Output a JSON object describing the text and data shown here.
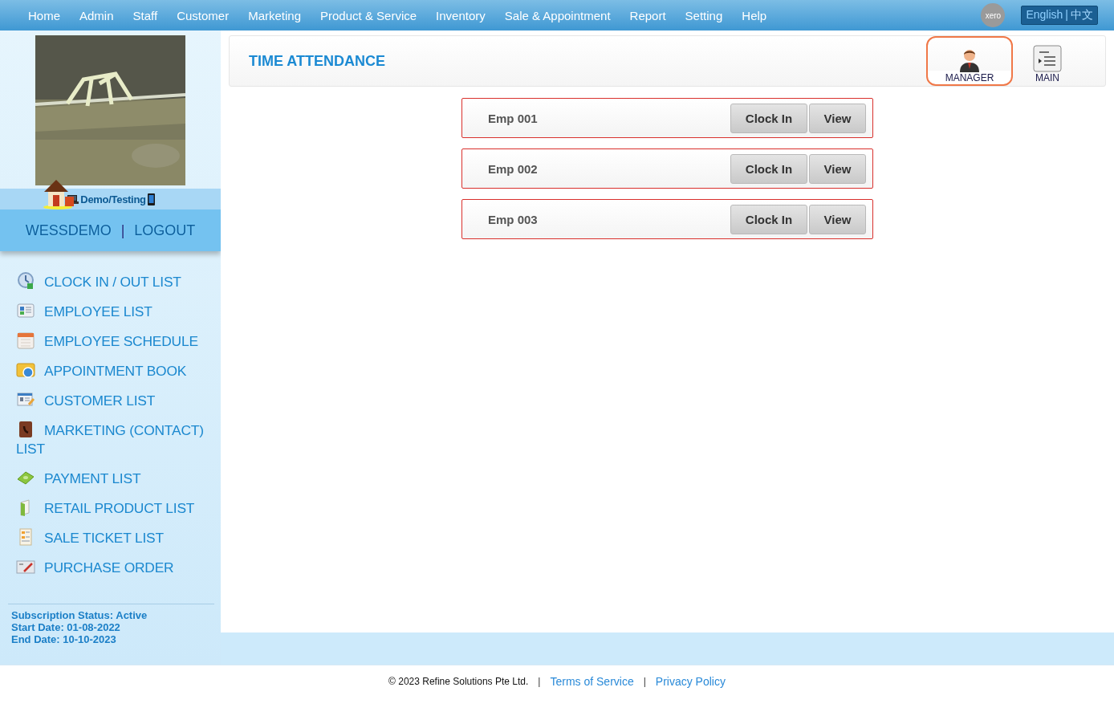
{
  "nav": {
    "items": [
      "Home",
      "Admin",
      "Staff",
      "Customer",
      "Marketing",
      "Product & Service",
      "Inventory",
      "Sale & Appointment",
      "Report",
      "Setting",
      "Help"
    ],
    "xero": "xero",
    "language": {
      "separator": "|",
      "options": [
        {
          "label": "English",
          "selected": true
        },
        {
          "label": "中文",
          "selected": false
        }
      ]
    }
  },
  "sidebar": {
    "photo": {
      "kind": "picture"
    },
    "mode": "Demo/Testing",
    "user": "WESSDEMO",
    "separator": "|",
    "logout": "LOGOUT",
    "menu": [
      "CLOCK IN / OUT LIST",
      "EMPLOYEE LIST",
      "EMPLOYEE SCHEDULE",
      "APPOINTMENT BOOK",
      "CUSTOMER LIST",
      "MARKETING (CONTACT) LIST",
      "PAYMENT LIST",
      "RETAIL PRODUCT LIST",
      "SALE TICKET LIST",
      "PURCHASE ORDER"
    ],
    "subscription": [
      "Subscription Status: Active",
      "Start Date: 01-08-2022",
      "End Date: 10-10-2023"
    ]
  },
  "header": {
    "title": "TIME ATTENDANCE",
    "views": [
      {
        "label": "MANAGER",
        "kind": "manager",
        "selected": true
      },
      {
        "label": "MAIN",
        "kind": "main",
        "selected": false
      }
    ]
  },
  "employees": [
    {
      "name": "Emp 001",
      "clock": "Clock In",
      "view": "View"
    },
    {
      "name": "Emp 002",
      "clock": "Clock In",
      "view": "View"
    },
    {
      "name": "Emp 003",
      "clock": "Clock In",
      "view": "View"
    }
  ],
  "footer": {
    "copyright": "© 2023 Refine Solutions Pte Ltd.",
    "separator1": "|",
    "terms": "Terms of Service",
    "separator2": "|",
    "privacy": "Privacy Policy"
  }
}
